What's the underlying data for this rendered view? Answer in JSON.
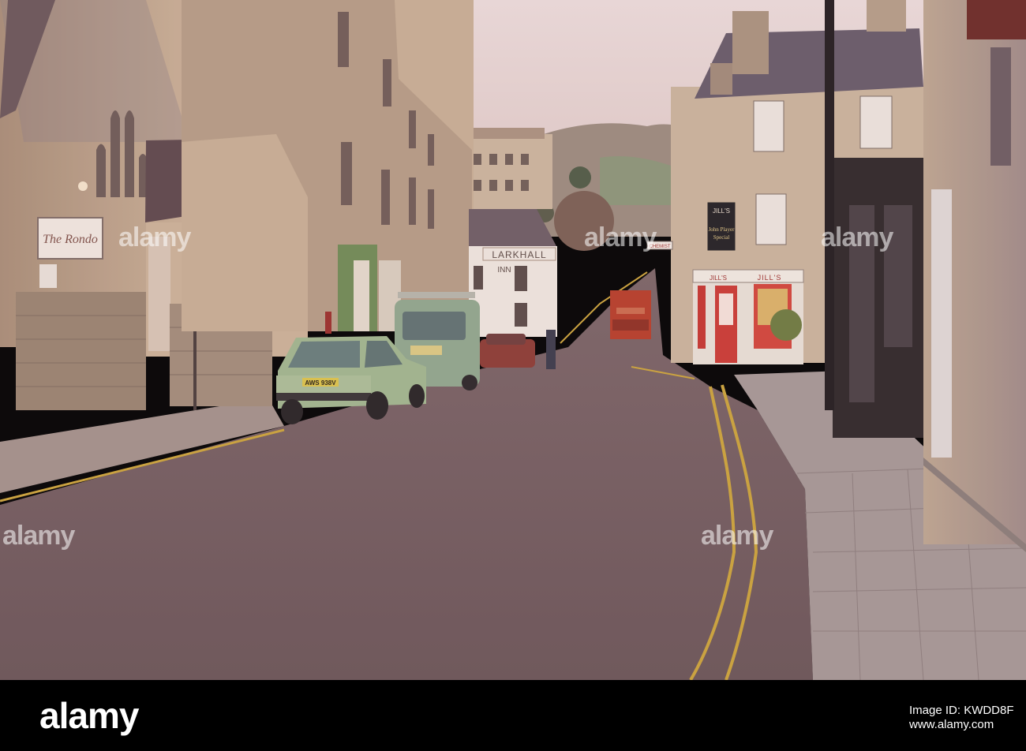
{
  "signs": {
    "rondo": "The Rondo",
    "larkhall": "LARKHALL",
    "inn": "INN",
    "jills_top": "JILL'S",
    "john_player": "John Player",
    "special": "Special",
    "jills_shop": "JILL'S",
    "jills_shop_right": "JILL'S",
    "chemist": "CHEMIST"
  },
  "plates": {
    "green_car": "AWS 938V"
  },
  "watermark": {
    "text": "alamy",
    "footer_logo": "alamy",
    "image_id": "Image ID: KWDD8F",
    "website": "www.alamy.com"
  }
}
